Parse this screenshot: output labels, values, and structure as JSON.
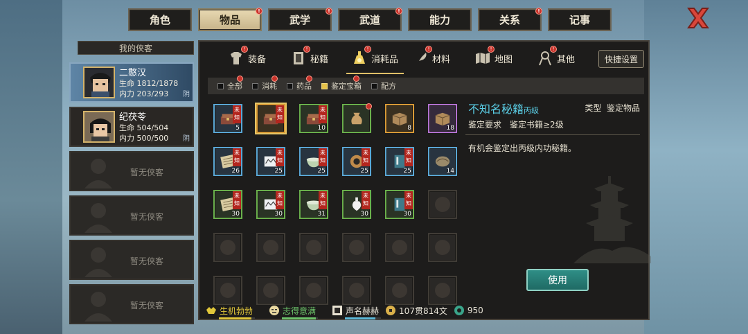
{
  "top_tabs": [
    {
      "label": "角色",
      "badge": false
    },
    {
      "label": "物品",
      "badge": true,
      "active": true
    },
    {
      "label": "武学",
      "badge": true
    },
    {
      "label": "武道",
      "badge": true
    },
    {
      "label": "能力",
      "badge": false
    },
    {
      "label": "关系",
      "badge": true
    },
    {
      "label": "记事",
      "badge": false
    }
  ],
  "heroes": {
    "header": "我的侠客",
    "list": [
      {
        "name": "二憨汉",
        "hp_label": "生命",
        "hp": "1812/1878",
        "mp_label": "内力",
        "mp": "203/293",
        "tag": "阴"
      },
      {
        "name": "纪茯苓",
        "hp_label": "生命",
        "hp": "504/504",
        "mp_label": "内力",
        "mp": "500/500",
        "tag": "阴"
      }
    ],
    "empty_label": "暂无侠客"
  },
  "sub_tabs": [
    {
      "label": "装备",
      "icon": "armor-icon",
      "badge": true
    },
    {
      "label": "秘籍",
      "icon": "book-icon",
      "badge": true
    },
    {
      "label": "消耗品",
      "icon": "potion-icon",
      "badge": true,
      "active": true
    },
    {
      "label": "材料",
      "icon": "feather-icon",
      "badge": true
    },
    {
      "label": "地图",
      "icon": "map-icon",
      "badge": true
    },
    {
      "label": "其他",
      "icon": "misc-icon",
      "badge": true
    }
  ],
  "quick_settings": "快捷设置",
  "filters": [
    {
      "label": "全部",
      "on": false,
      "badge": true
    },
    {
      "label": "消耗",
      "on": false,
      "badge": true
    },
    {
      "label": "药品",
      "on": false,
      "badge": true
    },
    {
      "label": "鉴定宝箱",
      "on": true,
      "badge": true
    },
    {
      "label": "配方",
      "on": false,
      "badge": false
    }
  ],
  "unknown_tag": "未知",
  "items": [
    {
      "quality": "blue",
      "art": "chest",
      "count": "5",
      "unknown": true
    },
    {
      "quality": "orange",
      "art": "chest",
      "count": "",
      "unknown": true,
      "selected": true
    },
    {
      "quality": "green",
      "art": "chest",
      "count": "10",
      "unknown": true
    },
    {
      "quality": "green",
      "art": "bag",
      "count": "",
      "unknown": false,
      "dot": true
    },
    {
      "quality": "orange",
      "art": "box",
      "count": "8",
      "unknown": false
    },
    {
      "quality": "purple",
      "art": "box",
      "count": "18",
      "unknown": false
    },
    {
      "quality": "blue",
      "art": "scroll",
      "count": "26",
      "unknown": true
    },
    {
      "quality": "blue",
      "art": "paper",
      "count": "25",
      "unknown": true
    },
    {
      "quality": "blue",
      "art": "bowl",
      "count": "25",
      "unknown": true
    },
    {
      "quality": "blue",
      "art": "ring",
      "count": "25",
      "unknown": true
    },
    {
      "quality": "blue",
      "art": "manual",
      "count": "25",
      "unknown": true
    },
    {
      "quality": "blue",
      "art": "shell",
      "count": "14",
      "unknown": false
    },
    {
      "quality": "green",
      "art": "scroll",
      "count": "30",
      "unknown": true
    },
    {
      "quality": "green",
      "art": "paper",
      "count": "30",
      "unknown": true
    },
    {
      "quality": "green",
      "art": "bowl",
      "count": "31",
      "unknown": true
    },
    {
      "quality": "green",
      "art": "vase",
      "count": "30",
      "unknown": true
    },
    {
      "quality": "green",
      "art": "manual",
      "count": "30",
      "unknown": true
    }
  ],
  "detail": {
    "name": "不知名秘籍",
    "grade": "丙级",
    "type_label": "类型",
    "type_value": "鉴定物品",
    "requirement": "鉴定要求　鉴定书籍≥2级",
    "description": "有机会鉴定出丙级内功秘籍。",
    "use_button": "使用"
  },
  "footer": {
    "vitality": "生机勃勃",
    "mood": "志得意满",
    "fame": "声名赫赫",
    "money": "107贯814文",
    "jade": "950",
    "colors": {
      "vitality": "#e0c63a",
      "mood": "#6cc36a",
      "fame": "#e8e2d2"
    }
  },
  "colors": {
    "accent_gold": "#e0c068",
    "item_name": "#5bd0e8",
    "use_button": "#2f8e86"
  }
}
